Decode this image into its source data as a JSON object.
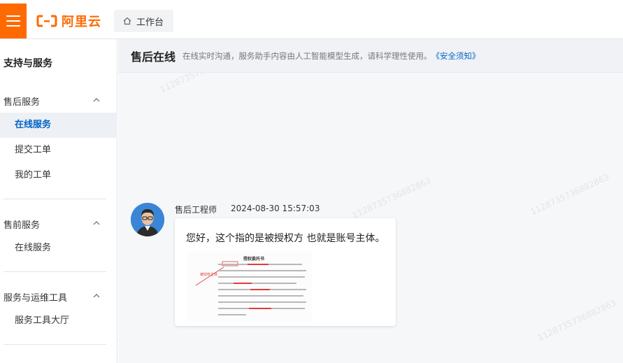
{
  "header": {
    "logo_text": "阿里云",
    "breadcrumb": "工作台"
  },
  "sidebar": {
    "title": "支持与服务",
    "groups": [
      {
        "title": "售后服务",
        "items": [
          "在线服务",
          "提交工单",
          "我的工单"
        ]
      },
      {
        "title": "售前服务",
        "items": [
          "在线服务"
        ]
      },
      {
        "title": "服务与运维工具",
        "items": [
          "服务工具大厅"
        ]
      }
    ]
  },
  "main": {
    "title": "售后在线",
    "description": "在线实时沟通，服务助手内容由人工智能模型生成，请科学理性使用。",
    "link": "《安全须知》",
    "watermark": "1128735736882863"
  },
  "message": {
    "sender": "售后工程师",
    "timestamp": "2024-08-30 15:57:03",
    "text": "您好，这个指的是被授权方 也就是账号主体。",
    "image_title": "授权委托书",
    "image_note": "被授权主体"
  },
  "colors": {
    "brand": "#ff6a00",
    "link": "#0064c8",
    "active_bg": "#edf0f4",
    "highlight_red": "#e23b3b"
  },
  "icons": [
    "menu-icon",
    "aliyun-logo-icon",
    "home-icon",
    "chevron-up-icon",
    "chevron-left-icon"
  ]
}
